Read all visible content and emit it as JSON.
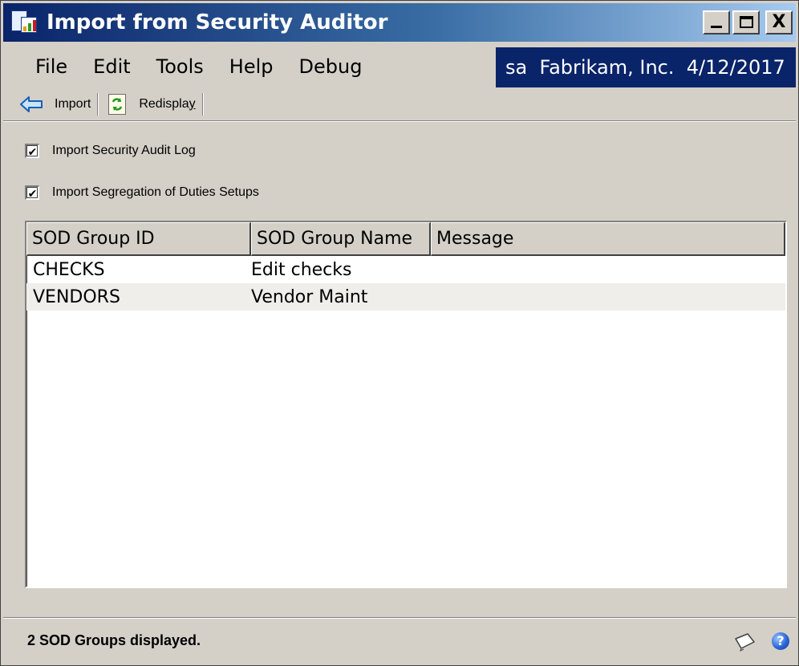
{
  "window": {
    "title": "Import from Security Auditor",
    "close_glyph": "X"
  },
  "menu": {
    "items": [
      "File",
      "Edit",
      "Tools",
      "Help",
      "Debug"
    ],
    "company_info": "sa  Fabrikam, Inc.  4/12/2017"
  },
  "toolbar": {
    "import_label": "Import",
    "redisplay_prefix": "Redispla",
    "redisplay_hotkey": "y"
  },
  "options": {
    "import_audit_log": {
      "label": "Import Security Audit Log",
      "checked": true,
      "mark": "✔"
    },
    "import_sod_setups": {
      "label": "Import Segregation of Duties Setups",
      "checked": true,
      "mark": "✔"
    }
  },
  "grid": {
    "columns": [
      "SOD Group ID",
      "SOD Group Name",
      "Message"
    ],
    "rows": [
      {
        "id": "CHECKS",
        "name": "Edit checks",
        "message": ""
      },
      {
        "id": "VENDORS",
        "name": "Vendor Maint",
        "message": ""
      }
    ]
  },
  "status": {
    "text": "2 SOD Groups displayed.",
    "help_glyph": "?"
  },
  "icons": {
    "app": "app-window-icon",
    "import": "arrow-left-icon",
    "redisplay": "refresh-document-icon",
    "note": "note-icon",
    "help": "help-icon"
  },
  "colors": {
    "title_gradient_start": "#0a246a",
    "title_gradient_end": "#a6caf0",
    "company_box": "#0a246a",
    "dialog_bg": "#d4d0c8"
  }
}
